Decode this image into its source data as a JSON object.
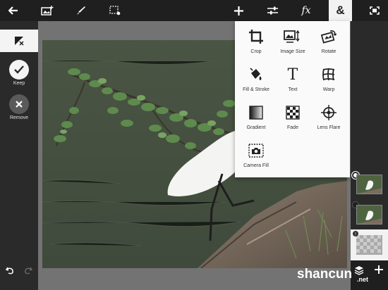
{
  "toolbar": {
    "items": [
      {
        "icon": "back-arrow-icon"
      },
      {
        "icon": "add-image-icon"
      },
      {
        "icon": "brush-icon"
      },
      {
        "icon": "selection-icon"
      },
      {
        "icon": "add-icon"
      },
      {
        "icon": "adjust-sliders-icon"
      },
      {
        "icon": "fx-icon",
        "label": "fx"
      },
      {
        "icon": "ampersand-icon",
        "label": "&"
      },
      {
        "icon": "fullscreen-icon"
      }
    ]
  },
  "left_panel": {
    "keep_label": "Keep",
    "remove_label": "Remove"
  },
  "menu": {
    "options": [
      {
        "label": "Crop",
        "icon": "crop-icon"
      },
      {
        "label": "Image Size",
        "icon": "image-size-icon"
      },
      {
        "label": "Rotate",
        "icon": "rotate-icon"
      },
      {
        "label": "Fill & Stroke",
        "icon": "fill-stroke-icon"
      },
      {
        "label": "Text",
        "icon": "text-icon"
      },
      {
        "label": "Warp",
        "icon": "warp-icon"
      },
      {
        "label": "Gradient",
        "icon": "gradient-icon"
      },
      {
        "label": "Fade",
        "icon": "fade-icon"
      },
      {
        "label": "Lens Flare",
        "icon": "lens-flare-icon"
      },
      {
        "label": "Camera Fill",
        "icon": "camera-fill-icon"
      }
    ]
  },
  "watermark": {
    "text": "shancun",
    "suffix": ".net"
  },
  "colors": {
    "toolbar": "#1f1f1f",
    "menu_bg": "#fafafa",
    "accent": "#ffffff"
  }
}
